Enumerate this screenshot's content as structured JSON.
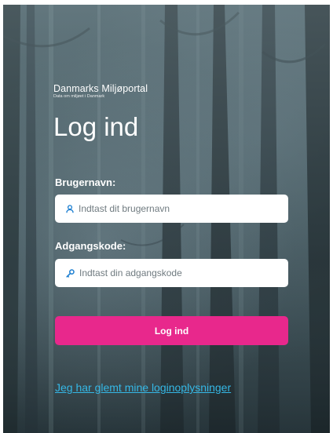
{
  "brand": {
    "name": "Danmarks Miljøportal",
    "subtitle": "Data om miljøet i Danmark"
  },
  "title": "Log ind",
  "username": {
    "label": "Brugernavn:",
    "placeholder": "Indtast dit brugernavn",
    "icon": "user-icon"
  },
  "password": {
    "label": "Adgangskode:",
    "placeholder": "Indtast din adgangskode",
    "icon": "key-icon"
  },
  "login_button": "Log ind",
  "forgot_link": "Jeg har glemt mine loginoplysninger",
  "colors": {
    "accent": "#e8288c",
    "link": "#35b8e6",
    "icon": "#1d7fd1"
  }
}
